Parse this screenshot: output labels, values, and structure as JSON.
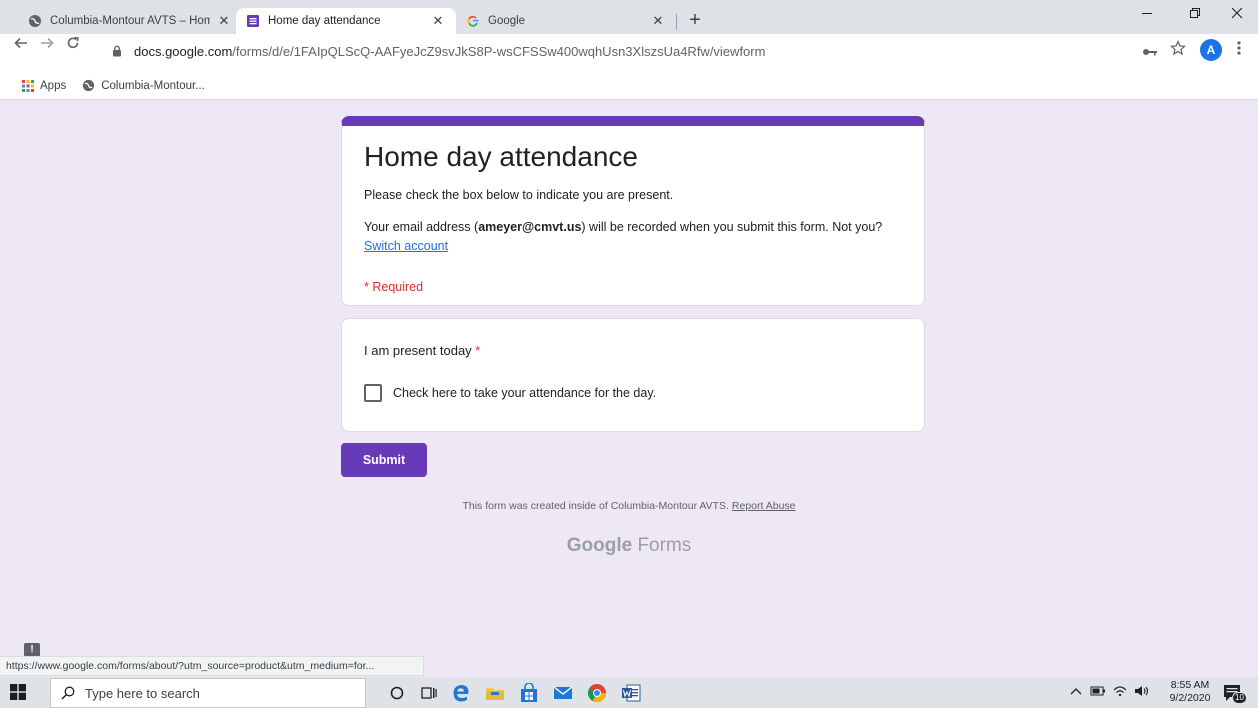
{
  "browser": {
    "tabs": [
      {
        "title": "Columbia-Montour AVTS – Home",
        "close": "✕",
        "active": false
      },
      {
        "title": "Home day attendance",
        "close": "✕",
        "active": true
      },
      {
        "title": "Google",
        "close": "✕",
        "active": false
      }
    ],
    "new_tab": "+",
    "url_host": "docs.google.com",
    "url_path": "/forms/d/e/1FAIpQLScQ-AAFyeJcZ9svJkS8P-wsCFSSw400wqhUsn3XlszsUa4Rfw/viewform",
    "avatar_letter": "A",
    "bookmarks": [
      {
        "label": "Apps",
        "icon": "apps-grid-icon"
      },
      {
        "label": "Columbia-Montour...",
        "icon": "globe-icon"
      }
    ]
  },
  "form": {
    "title": "Home day attendance",
    "description": "Please check the box below to indicate you are present.",
    "email_prefix": "Your email address (",
    "email": "ameyer@cmvt.us",
    "email_suffix": ") will be recorded when you submit this form. Not you?",
    "switch_account": "Switch account",
    "required_note": "* Required",
    "question": {
      "title": "I am present today",
      "required_mark": "*",
      "option_label": "Check here to take your attendance for the day.",
      "checked": false
    },
    "submit_label": "Submit",
    "footer_text": "This form was created inside of Columbia-Montour AVTS.",
    "report_abuse": "Report Abuse",
    "brand_google": "Google",
    "brand_forms": "Forms"
  },
  "status_url": "https://www.google.com/forms/about/?utm_source=product&utm_medium=for...",
  "feedback_label": "!",
  "taskbar": {
    "search_placeholder": "Type here to search",
    "time": "8:55 AM",
    "date": "9/2/2020",
    "notification_count": "10"
  },
  "colors": {
    "accent": "#673ab7",
    "page_bg": "#ede7f6",
    "required": "#d93025",
    "link": "#1a73e8"
  }
}
